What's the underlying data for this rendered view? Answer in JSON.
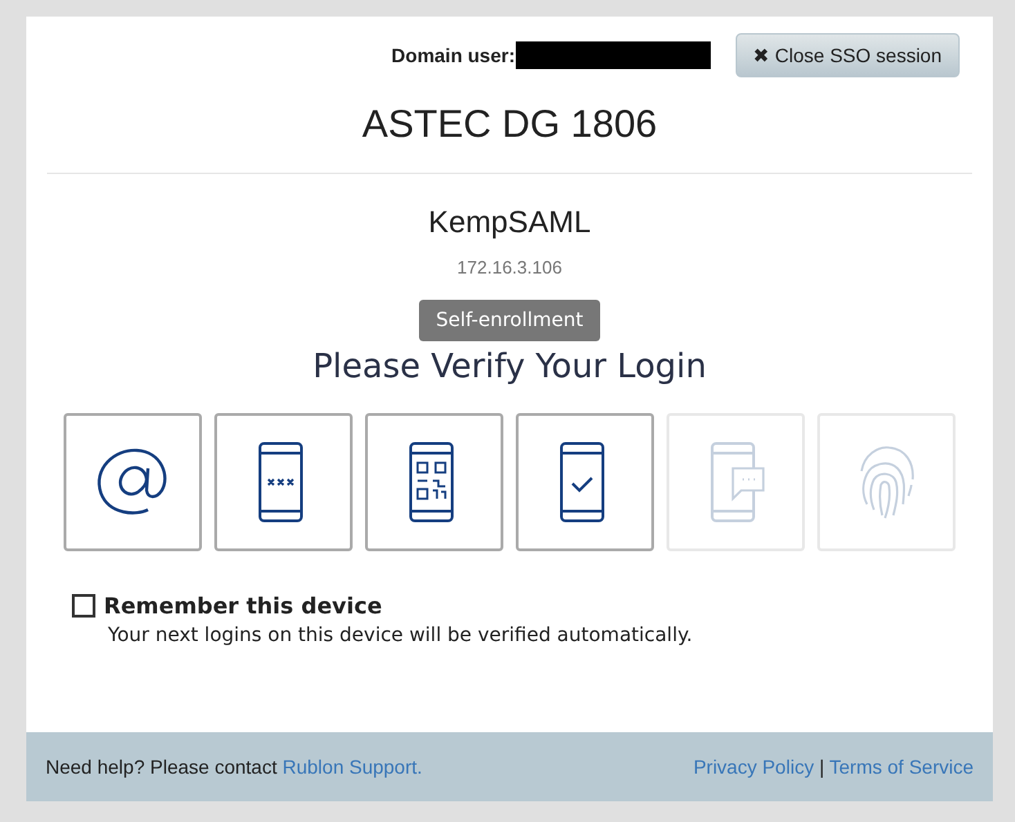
{
  "header": {
    "domain_user_label": "Domain user:",
    "close_button": "Close SSO session",
    "close_icon": "✖"
  },
  "title": "ASTEC DG 1806",
  "application": {
    "name": "KempSAML",
    "address": "172.16.3.106"
  },
  "enrollment_button": "Self-enrollment",
  "heading": "Please Verify Your Login",
  "methods": [
    {
      "kind": "email",
      "disabled": false
    },
    {
      "kind": "passcode",
      "disabled": false
    },
    {
      "kind": "qr",
      "disabled": false
    },
    {
      "kind": "push",
      "disabled": false
    },
    {
      "kind": "sms",
      "disabled": true
    },
    {
      "kind": "fingerprint",
      "disabled": true
    }
  ],
  "remember": {
    "label": "Remember this device",
    "checked": false,
    "hint": "Your next logins on this device will be verified automatically."
  },
  "footer": {
    "help_text": "Need help? Please contact ",
    "support_link": "Rublon Support.",
    "privacy_link": "Privacy Policy",
    "separator": "|",
    "terms_link": "Terms of Service"
  }
}
